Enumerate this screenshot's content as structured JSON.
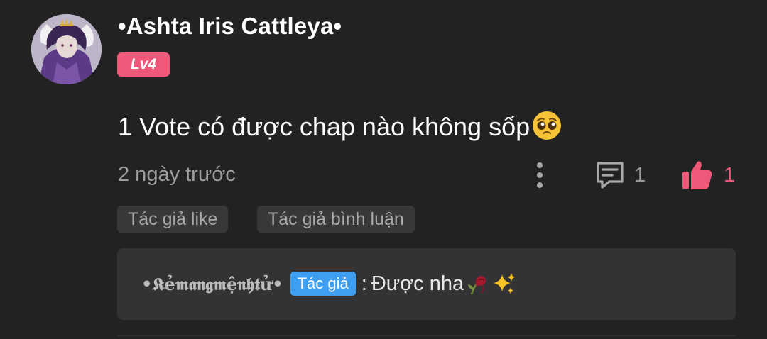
{
  "comment": {
    "username": "•Ashta Iris Cattleya•",
    "level": "Lv4",
    "content": "1 Vote có được chap nào không sốp",
    "content_emoji": "pleading-face-emoji",
    "time": "2 ngày trước",
    "reply_count": "1",
    "like_count": "1",
    "tags": {
      "author_like": "Tác giả like",
      "author_reply": "Tác giả bình luận"
    },
    "reply": {
      "author": "•𝕶ẻ𝖒𝖆𝖓𝖌𝖒ệ𝖓𝖍𝖙ử•",
      "badge": "Tác giả",
      "separator": ":",
      "text": "Được nha",
      "emojis": [
        "wilted-flower-emoji",
        "sparkles-emoji"
      ]
    }
  },
  "icons": {
    "more": "more-vertical-icon",
    "reply": "comment-icon",
    "like": "thumbs-up-icon"
  },
  "colors": {
    "background": "#222223",
    "accent_pink": "#f0587a",
    "author_blue": "#3e9ff2",
    "muted_text": "#9c9c9c",
    "card": "#333335"
  }
}
